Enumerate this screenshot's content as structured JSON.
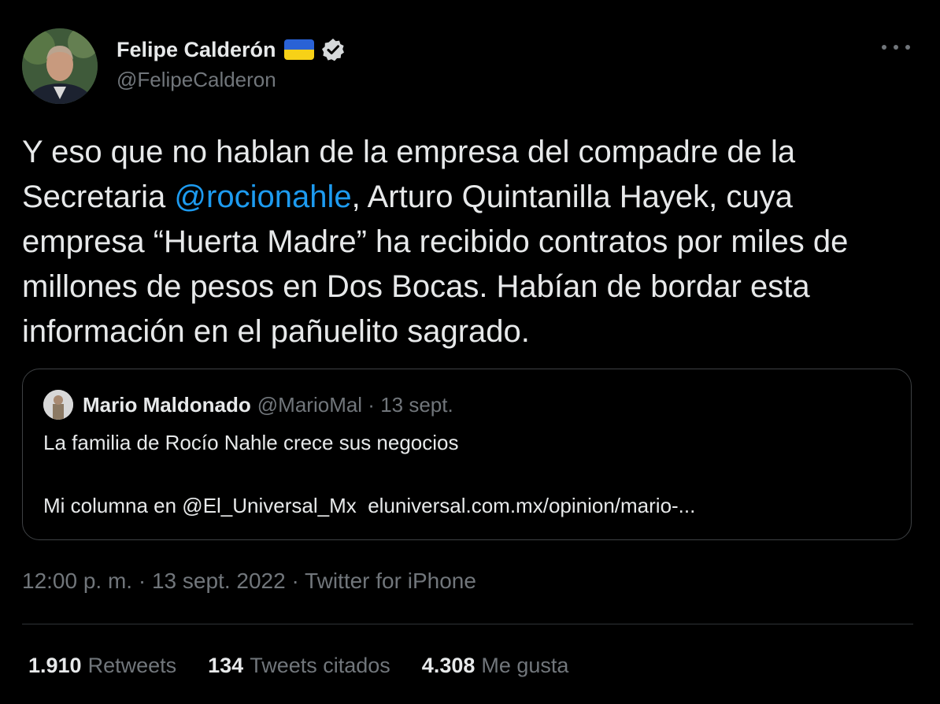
{
  "author": {
    "display_name": "Felipe Calderón",
    "handle": "@FelipeCalderon",
    "flag": {
      "top": "#2a62d6",
      "bottom": "#f7d117"
    },
    "verified_icon": "verified-badge-icon"
  },
  "tweet": {
    "text_parts": [
      "Y eso que no hablan de la empresa del compadre de la Secretaria ",
      "@rocionahle",
      ", Arturo Quintanilla Hayek, cuya empresa “Huerta Madre” ha recibido contratos por miles de millones de pesos en Dos Bocas. Habían de bordar esta información en el pañuelito sagrado."
    ]
  },
  "quote": {
    "display_name": "Mario Maldonado",
    "handle_and_date": "@MarioMal · 13 sept.",
    "line1": "La familia de Rocío Nahle crece sus negocios",
    "line2": "Mi columna en @El_Universal_Mx  eluniversal.com.mx/opinion/mario-..."
  },
  "meta": "12:00 p. m. · 13 sept. 2022 · Twitter for iPhone",
  "stats": [
    {
      "count": "1.910",
      "label": "Retweets"
    },
    {
      "count": "134",
      "label": "Tweets citados"
    },
    {
      "count": "4.308",
      "label": "Me gusta"
    }
  ],
  "colors": {
    "background": "#000000",
    "text": "#e7e9ea",
    "secondary": "#71767b",
    "link": "#1d9bf0",
    "border": "#3e4144"
  }
}
